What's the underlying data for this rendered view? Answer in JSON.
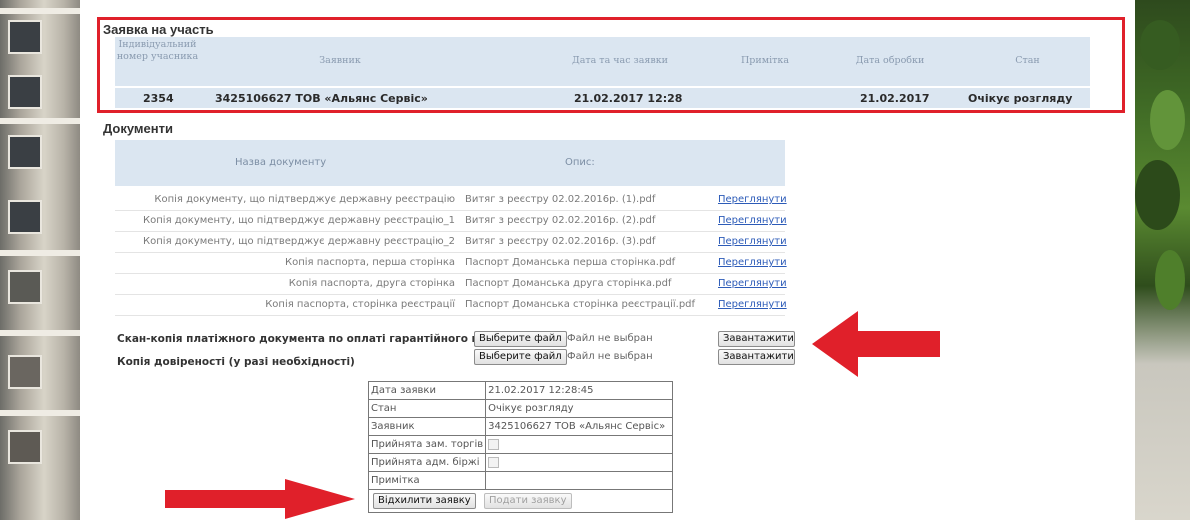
{
  "application": {
    "title": "Заявка на участь",
    "headers": [
      "Індивідуальний номер учасника",
      "Заявник",
      "Дата та час заявки",
      "Примітка",
      "Дата обробки",
      "Стан"
    ],
    "row": {
      "id": "2354",
      "applicant": "3425106627 ТОВ «Альянс Сервіс»",
      "datetime": "21.02.2017 12:28",
      "note": "",
      "processed": "21.02.2017",
      "status": "Очікує розгляду"
    }
  },
  "documents": {
    "title": "Документи",
    "headers": [
      "Назва документу",
      "Опис:"
    ],
    "view_label": "Переглянути",
    "rows": [
      {
        "name": "Копія документу, що підтверджує державну реєстрацію",
        "file": "Витяг з реєстру 02.02.2016р. (1).pdf"
      },
      {
        "name": "Копія документу, що підтверджує державну реєстрацію_1",
        "file": "Витяг з реєстру 02.02.2016р. (2).pdf"
      },
      {
        "name": "Копія документу, що підтверджує державну реєстрацію_2",
        "file": "Витяг з реєстру 02.02.2016р. (3).pdf"
      },
      {
        "name": "Копія паспорта, перша сторінка",
        "file": "Паспорт Доманська перша сторінка.pdf"
      },
      {
        "name": "Копія паспорта, друга сторінка",
        "file": "Паспорт Доманська друга сторінка.pdf"
      },
      {
        "name": "Копія паспорта, сторінка реєстрації",
        "file": "Паспорт Доманська сторінка реєстрації.pdf"
      }
    ]
  },
  "uploads": [
    {
      "label": "Скан-копія платіжного документа по оплаті гарантійного внеску",
      "choose": "Выберите файл",
      "nofile": "Файл не выбран",
      "upload": "Завантажити"
    },
    {
      "label": "Копія довіреності (у разі необхідності)",
      "choose": "Выберите файл",
      "nofile": "Файл не выбран",
      "upload": "Завантажити"
    }
  ],
  "summary": {
    "rows": [
      {
        "key": "Дата заявки",
        "value": "21.02.2017 12:28:45"
      },
      {
        "key": "Стан",
        "value": "Очікує розгляду"
      },
      {
        "key": "Заявник",
        "value": "3425106627 ТОВ «Альянс Сервіс»"
      },
      {
        "key": "Прийнята зам. торгів",
        "value": ""
      },
      {
        "key": "Прийнята адм. біржі",
        "value": ""
      },
      {
        "key": "Примітка",
        "value": ""
      }
    ],
    "reject_label": "Відхилити заявку",
    "submit_label": "Подати заявку"
  },
  "colors": {
    "highlight_box": "#e0202a",
    "arrow": "#e0202a",
    "header_bg": "#dbe6f1",
    "link": "#2c5bb8"
  }
}
